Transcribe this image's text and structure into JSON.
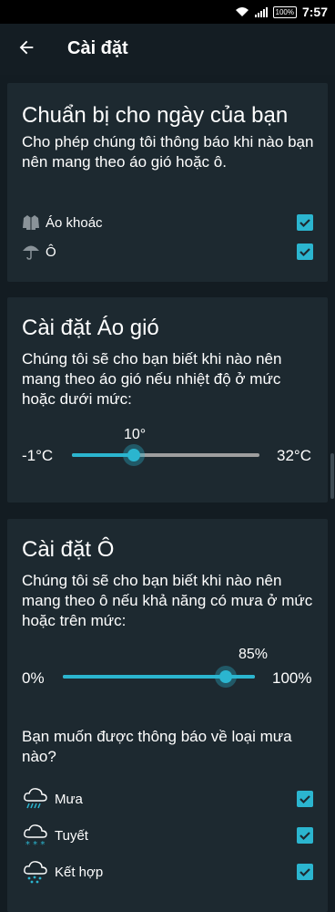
{
  "status_bar": {
    "time": "7:57",
    "battery": "100%"
  },
  "header": {
    "title": "Cài đặt",
    "back_icon": "arrow-back-icon"
  },
  "colors": {
    "accent": "#2bb5cf",
    "background": "#131c22",
    "card": "#1d2930"
  },
  "prepare_card": {
    "title": "Chuẩn bị cho ngày của bạn",
    "description": "Cho phép chúng tôi thông báo khi nào bạn nên mang theo áo gió hoặc ô.",
    "items": [
      {
        "label": "Áo khoác",
        "icon": "jacket-icon",
        "checked": true
      },
      {
        "label": "Ô",
        "icon": "umbrella-icon",
        "checked": true
      }
    ]
  },
  "jacket_card": {
    "title": "Cài đặt Áo gió",
    "description": "Chúng tôi sẽ cho bạn biết khi nào nên mang theo áo gió nếu nhiệt độ ở mức hoặc dưới mức:",
    "slider": {
      "min_label": "-1°C",
      "max_label": "32°C",
      "value_label": "10°",
      "min": -1,
      "max": 32,
      "value": 10
    }
  },
  "umbrella_card": {
    "title": "Cài đặt Ô",
    "description": "Chúng tôi sẽ cho bạn biết khi nào nên mang theo ô nếu khả năng có mưa ở mức hoặc trên mức:",
    "slider": {
      "min_label": "0%",
      "max_label": "100%",
      "value_label": "85%",
      "min": 0,
      "max": 100,
      "value": 85
    },
    "question": "Bạn muốn được thông báo về loại mưa nào?",
    "items": [
      {
        "label": "Mưa",
        "icon": "rain-cloud-icon",
        "checked": true
      },
      {
        "label": "Tuyết",
        "icon": "snow-cloud-icon",
        "checked": true
      },
      {
        "label": "Kết hợp",
        "icon": "mixed-cloud-icon",
        "checked": true
      }
    ]
  }
}
